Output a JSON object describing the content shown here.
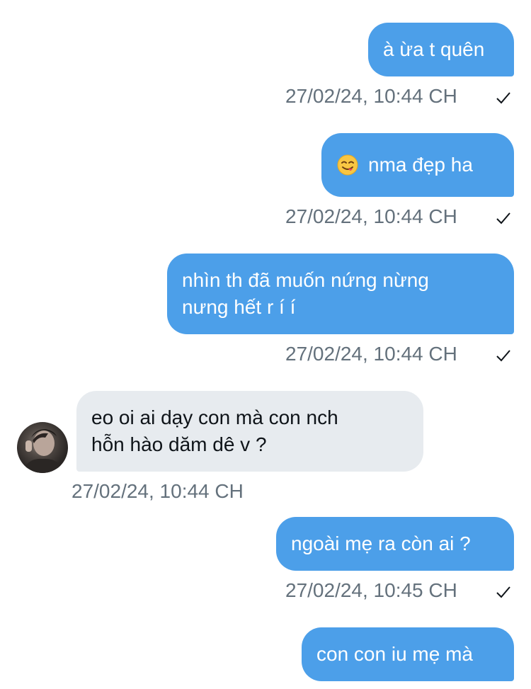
{
  "conversation": {
    "messages": [
      {
        "direction": "outgoing",
        "lines": [
          "à ừa t quên"
        ],
        "timestamp": "27/02/24, 10:44 CH",
        "status": "sent-check"
      },
      {
        "direction": "outgoing",
        "emoji": "face-savoring-food-emoji",
        "lines": [
          "nma đẹp ha"
        ],
        "timestamp": "27/02/24, 10:44 CH",
        "status": "sent-check"
      },
      {
        "direction": "outgoing",
        "lines": [
          "nhìn th đã muốn nứng nừng",
          "nưng hết r í í"
        ],
        "timestamp": "27/02/24, 10:44 CH",
        "status": "sent-check"
      },
      {
        "direction": "incoming",
        "lines": [
          "eo oi ai dạy con mà con nch",
          "hỗn hào dăm dê v ?"
        ],
        "timestamp": "27/02/24, 10:44 CH"
      },
      {
        "direction": "outgoing",
        "lines": [
          "ngoài mẹ ra còn ai ?"
        ],
        "timestamp": "27/02/24, 10:45 CH",
        "status": "sent-check"
      },
      {
        "direction": "outgoing",
        "lines": [
          "con con iu mẹ mà"
        ]
      }
    ]
  },
  "colors": {
    "outgoing_bubble": "#4c9fe9",
    "incoming_bubble": "#e7ebef",
    "timestamp_text": "#64717c",
    "background": "#ffffff"
  }
}
